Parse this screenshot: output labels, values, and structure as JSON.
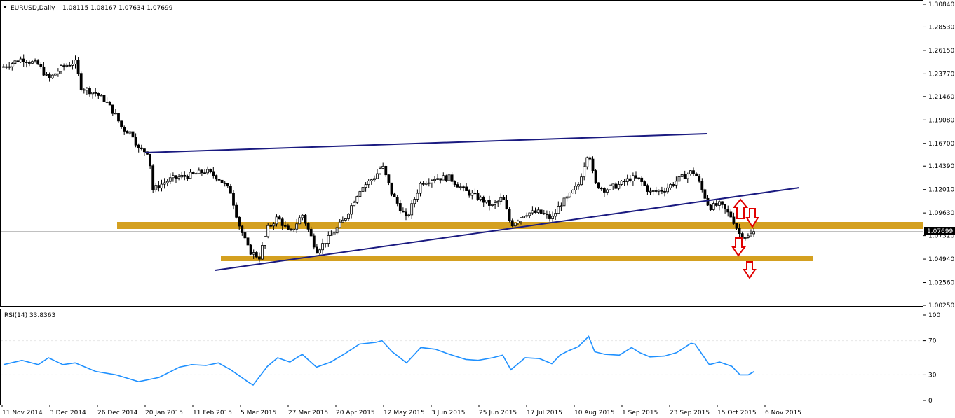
{
  "header": {
    "symbol_label": "EURUSD,Daily",
    "ohlc": "1.08115 1.08167 1.07634 1.07699"
  },
  "rsi_panel": {
    "label": "RSI(14) 33.8363",
    "levels": [
      "100",
      "70",
      "30",
      "0"
    ]
  },
  "current_price": "1.07699",
  "colors": {
    "candle": "#000000",
    "trendline": "#1a1a80",
    "support_zone": "#d4a020",
    "rsi_line": "#1e90ff",
    "arrow": "#e00000"
  },
  "chart_data": {
    "type": "candlestick",
    "symbol": "EURUSD",
    "timeframe": "Daily",
    "price_axis_ticks": [
      "1.30840",
      "1.28530",
      "1.26150",
      "1.23770",
      "1.21460",
      "1.19080",
      "1.16700",
      "1.14390",
      "1.12010",
      "1.09630",
      "1.07320",
      "1.04940",
      "1.02560",
      "1.00250"
    ],
    "x_tick_labels": [
      "11 Nov 2014",
      "3 Dec 2014",
      "26 Dec 2014",
      "20 Jan 2015",
      "11 Feb 2015",
      "5 Mar 2015",
      "27 Mar 2015",
      "20 Apr 2015",
      "12 May 2015",
      "3 Jun 2015",
      "25 Jun 2015",
      "17 Jul 2015",
      "10 Aug 2015",
      "1 Sep 2015",
      "23 Sep 2015",
      "15 Oct 2015",
      "6 Nov 2015"
    ],
    "ylim": [
      1.0025,
      1.3084
    ],
    "close_series": [
      [
        "2014-11-11",
        1.245
      ],
      [
        "2014-11-20",
        1.253
      ],
      [
        "2014-11-28",
        1.247
      ],
      [
        "2014-12-03",
        1.232
      ],
      [
        "2014-12-10",
        1.245
      ],
      [
        "2014-12-16",
        1.25
      ],
      [
        "2014-12-19",
        1.224
      ],
      [
        "2014-12-26",
        1.218
      ],
      [
        "2014-12-31",
        1.21
      ],
      [
        "2015-01-05",
        1.195
      ],
      [
        "2015-01-08",
        1.182
      ],
      [
        "2015-01-13",
        1.177
      ],
      [
        "2015-01-16",
        1.161
      ],
      [
        "2015-01-21",
        1.158
      ],
      [
        "2015-01-23",
        1.12
      ],
      [
        "2015-01-26",
        1.124
      ],
      [
        "2015-02-01",
        1.131
      ],
      [
        "2015-02-11",
        1.135
      ],
      [
        "2015-02-18",
        1.139
      ],
      [
        "2015-02-24",
        1.132
      ],
      [
        "2015-03-02",
        1.118
      ],
      [
        "2015-03-06",
        1.085
      ],
      [
        "2015-03-11",
        1.058
      ],
      [
        "2015-03-16",
        1.051
      ],
      [
        "2015-03-20",
        1.08
      ],
      [
        "2015-03-25",
        1.092
      ],
      [
        "2015-03-31",
        1.075
      ],
      [
        "2015-04-06",
        1.095
      ],
      [
        "2015-04-13",
        1.058
      ],
      [
        "2015-04-20",
        1.073
      ],
      [
        "2015-04-27",
        1.091
      ],
      [
        "2015-05-04",
        1.12
      ],
      [
        "2015-05-12",
        1.134
      ],
      [
        "2015-05-15",
        1.145
      ],
      [
        "2015-05-20",
        1.115
      ],
      [
        "2015-05-27",
        1.09
      ],
      [
        "2015-06-03",
        1.127
      ],
      [
        "2015-06-10",
        1.132
      ],
      [
        "2015-06-17",
        1.132
      ],
      [
        "2015-06-25",
        1.118
      ],
      [
        "2015-07-01",
        1.112
      ],
      [
        "2015-07-08",
        1.103
      ],
      [
        "2015-07-13",
        1.112
      ],
      [
        "2015-07-17",
        1.084
      ],
      [
        "2015-07-24",
        1.096
      ],
      [
        "2015-07-31",
        1.097
      ],
      [
        "2015-08-06",
        1.09
      ],
      [
        "2015-08-10",
        1.105
      ],
      [
        "2015-08-14",
        1.112
      ],
      [
        "2015-08-19",
        1.125
      ],
      [
        "2015-08-24",
        1.161
      ],
      [
        "2015-08-27",
        1.126
      ],
      [
        "2015-09-01",
        1.12
      ],
      [
        "2015-09-08",
        1.125
      ],
      [
        "2015-09-14",
        1.132
      ],
      [
        "2015-09-18",
        1.13
      ],
      [
        "2015-09-23",
        1.117
      ],
      [
        "2015-09-30",
        1.12
      ],
      [
        "2015-10-06",
        1.129
      ],
      [
        "2015-10-13",
        1.138
      ],
      [
        "2015-10-15",
        1.137
      ],
      [
        "2015-10-22",
        1.102
      ],
      [
        "2015-10-27",
        1.105
      ],
      [
        "2015-11-02",
        1.092
      ],
      [
        "2015-11-06",
        1.074
      ],
      [
        "2015-11-10",
        1.072
      ],
      [
        "2015-11-13",
        1.077
      ]
    ],
    "rsi_series": [
      [
        "2014-11-11",
        42
      ],
      [
        "2014-11-20",
        47
      ],
      [
        "2014-11-28",
        42
      ],
      [
        "2014-12-03",
        50
      ],
      [
        "2014-12-10",
        42
      ],
      [
        "2014-12-16",
        44
      ],
      [
        "2014-12-26",
        34
      ],
      [
        "2015-01-05",
        30
      ],
      [
        "2015-01-16",
        22
      ],
      [
        "2015-01-26",
        27
      ],
      [
        "2015-02-05",
        39
      ],
      [
        "2015-02-11",
        42
      ],
      [
        "2015-02-18",
        41
      ],
      [
        "2015-02-24",
        44
      ],
      [
        "2015-03-02",
        36
      ],
      [
        "2015-03-11",
        21
      ],
      [
        "2015-03-13",
        18
      ],
      [
        "2015-03-20",
        40
      ],
      [
        "2015-03-25",
        50
      ],
      [
        "2015-03-31",
        45
      ],
      [
        "2015-04-06",
        54
      ],
      [
        "2015-04-13",
        39
      ],
      [
        "2015-04-20",
        45
      ],
      [
        "2015-04-27",
        55
      ],
      [
        "2015-05-04",
        66
      ],
      [
        "2015-05-12",
        68
      ],
      [
        "2015-05-15",
        70
      ],
      [
        "2015-05-20",
        57
      ],
      [
        "2015-05-27",
        44
      ],
      [
        "2015-06-03",
        62
      ],
      [
        "2015-06-10",
        60
      ],
      [
        "2015-06-17",
        54
      ],
      [
        "2015-06-25",
        48
      ],
      [
        "2015-07-01",
        47
      ],
      [
        "2015-07-08",
        50
      ],
      [
        "2015-07-13",
        53
      ],
      [
        "2015-07-17",
        36
      ],
      [
        "2015-07-24",
        50
      ],
      [
        "2015-07-31",
        49
      ],
      [
        "2015-08-06",
        43
      ],
      [
        "2015-08-10",
        53
      ],
      [
        "2015-08-14",
        58
      ],
      [
        "2015-08-19",
        63
      ],
      [
        "2015-08-24",
        75
      ],
      [
        "2015-08-27",
        57
      ],
      [
        "2015-09-01",
        54
      ],
      [
        "2015-09-08",
        53
      ],
      [
        "2015-09-14",
        62
      ],
      [
        "2015-09-18",
        56
      ],
      [
        "2015-09-23",
        51
      ],
      [
        "2015-09-30",
        52
      ],
      [
        "2015-10-06",
        56
      ],
      [
        "2015-10-13",
        67
      ],
      [
        "2015-10-15",
        66
      ],
      [
        "2015-10-22",
        42
      ],
      [
        "2015-10-27",
        45
      ],
      [
        "2015-11-02",
        40
      ],
      [
        "2015-11-06",
        30
      ],
      [
        "2015-11-10",
        30
      ],
      [
        "2015-11-13",
        34
      ]
    ],
    "annotations": {
      "upper_trendline": [
        [
          "2015-01-21",
          1.161
        ],
        [
          "2015-10-20",
          1.178
        ]
      ],
      "lower_trendline": [
        [
          "2015-03-03",
          1.039
        ],
        [
          "2015-11-25",
          1.121
        ]
      ],
      "support_zone_upper": {
        "price": 1.081,
        "from": "2015-01-01",
        "to": "2015-11-30"
      },
      "support_zone_lower": {
        "price": 1.0525,
        "from": "2015-03-03",
        "to": "2015-11-27"
      },
      "arrows": [
        {
          "direction": "up",
          "date": "2015-11-15",
          "price": 1.097
        },
        {
          "direction": "down",
          "date": "2015-11-19",
          "price": 1.091
        },
        {
          "direction": "down",
          "date": "2015-11-14",
          "price": 1.062
        },
        {
          "direction": "down",
          "date": "2015-11-17",
          "price": 1.039
        }
      ]
    }
  }
}
